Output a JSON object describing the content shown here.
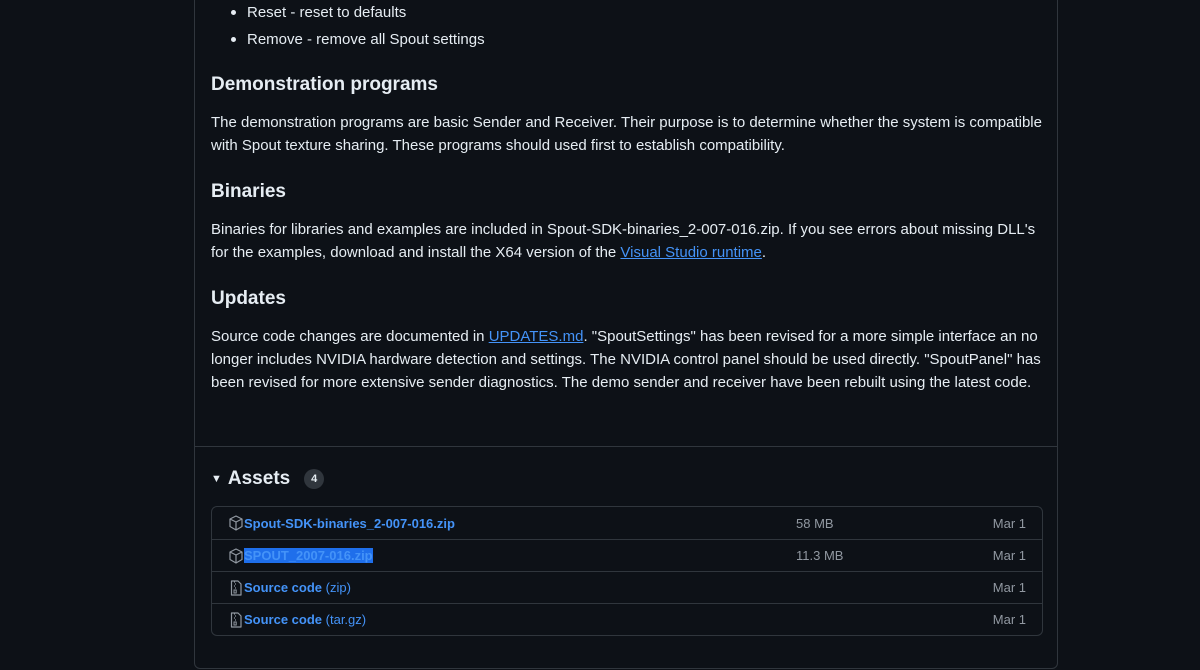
{
  "bullets": [
    "Reset - reset to defaults",
    "Remove - remove all Spout settings"
  ],
  "sections": {
    "demo": {
      "heading": "Demonstration programs",
      "text": "The demonstration programs are basic Sender and Receiver. Their purpose is to determine whether the system is compatible with Spout texture sharing. These programs should used first to establish compatibility."
    },
    "binaries": {
      "heading": "Binaries",
      "text_before": "Binaries for libraries and examples are included in Spout-SDK-binaries_2-007-016.zip. If you see errors about missing DLL's for the examples, download and install the X64 version of the ",
      "link": "Visual Studio runtime",
      "text_after": "."
    },
    "updates": {
      "heading": "Updates",
      "text_before": "Source code changes are documented in ",
      "link": "UPDATES.md",
      "text_after": ". \"SpoutSettings\" has been revised for a more simple interface an no longer includes NVIDIA hardware detection and settings. The NVIDIA control panel should be used directly. \"SpoutPanel\" has been revised for more extensive sender diagnostics. The demo sender and receiver have been rebuilt using the latest code."
    }
  },
  "assets": {
    "title": "Assets",
    "count": "4",
    "items": [
      {
        "name": "Spout-SDK-binaries_2-007-016.zip",
        "suffix": "",
        "size": "58 MB",
        "date": "Mar 1",
        "icon": "package-icon"
      },
      {
        "name": "SPOUT_2007-016.zip",
        "suffix": "",
        "size": "11.3 MB",
        "date": "Mar 1",
        "icon": "package-icon"
      },
      {
        "name": "Source code",
        "suffix": " (zip)",
        "size": "",
        "date": "Mar 1",
        "icon": "file-zip-icon"
      },
      {
        "name": "Source code",
        "suffix": " (tar.gz)",
        "size": "",
        "date": "Mar 1",
        "icon": "file-zip-icon"
      }
    ]
  }
}
